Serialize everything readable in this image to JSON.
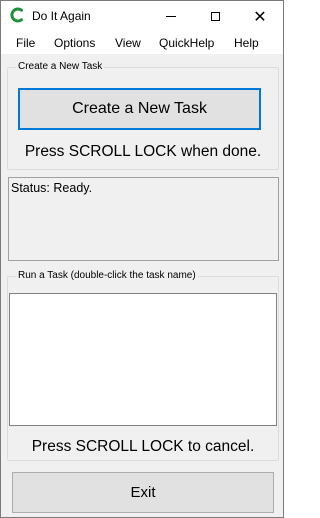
{
  "window": {
    "title": "Do It Again",
    "app_icon": "do-it-again-app-icon",
    "controls": {
      "minimize_icon": "minimize-icon",
      "maximize_icon": "maximize-icon",
      "close_icon": "close-icon",
      "close_glyph": "✕"
    }
  },
  "menu": {
    "items": [
      {
        "label": "File"
      },
      {
        "label": "Options"
      },
      {
        "label": "View"
      },
      {
        "label": "QuickHelp"
      },
      {
        "label": "Help"
      }
    ]
  },
  "create_group": {
    "label": "Create a New Task",
    "button_label": "Create a New Task",
    "hint": "Press SCROLL LOCK when done."
  },
  "status": {
    "text": "Status: Ready."
  },
  "run_group": {
    "label": "Run a Task (double-click the task name)",
    "tasks": [],
    "hint": "Press SCROLL LOCK to cancel."
  },
  "footer": {
    "exit_label": "Exit"
  },
  "colors": {
    "accent": "#0078d7",
    "icon_green": "#1f8f3a",
    "window_bg": "#f0f0f0",
    "button_bg": "#e1e1e1"
  }
}
